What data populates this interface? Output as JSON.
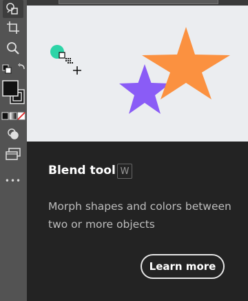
{
  "toolbar": {
    "tools": [
      {
        "name": "shape-builder-icon"
      },
      {
        "name": "artboard-icon"
      },
      {
        "name": "zoom-icon"
      },
      {
        "name": "swap-colors-icon"
      },
      {
        "name": "fill-stroke-swatch-icon"
      },
      {
        "name": "color-mode-icon"
      },
      {
        "name": "draw-mode-icon"
      },
      {
        "name": "screen-mode-icon"
      },
      {
        "name": "more-tools-icon"
      }
    ],
    "more_label": "•••"
  },
  "tooltip": {
    "title": "Blend tool",
    "shortcut": "W",
    "description": "Morph shapes and colors between two or more objects",
    "learn_more": "Learn more"
  },
  "colors": {
    "illustration_bg": "#ebedf0",
    "purple_star": "#8a5cf6",
    "orange_star": "#fb9140",
    "teal_dot": "#2dd4a7",
    "panel_bg": "#232323"
  }
}
